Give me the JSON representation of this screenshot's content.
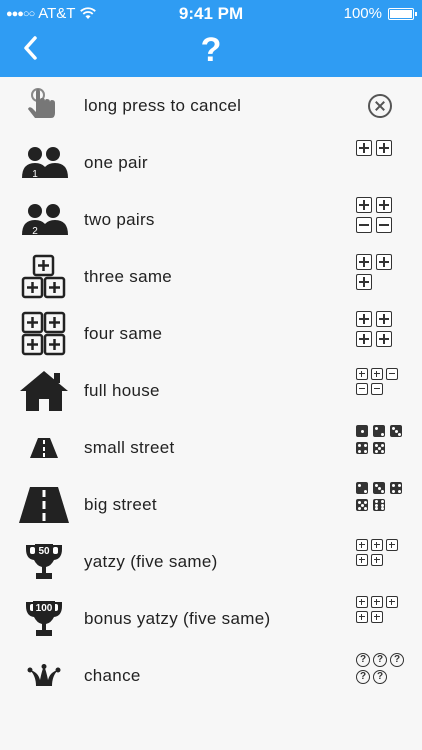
{
  "statusbar": {
    "carrier": "AT&T",
    "time": "9:41 PM",
    "battery": "100%"
  },
  "navbar": {
    "title": "?"
  },
  "rows": [
    {
      "label": "long press to cancel",
      "icon": "hand-press-icon"
    },
    {
      "label": "one pair",
      "icon": "pair-icon"
    },
    {
      "label": "two pairs",
      "icon": "two-pairs-icon"
    },
    {
      "label": "three same",
      "icon": "three-same-icon"
    },
    {
      "label": "four same",
      "icon": "four-same-icon"
    },
    {
      "label": "full house",
      "icon": "house-icon"
    },
    {
      "label": "small street",
      "icon": "small-road-icon"
    },
    {
      "label": "big street",
      "icon": "big-road-icon"
    },
    {
      "label": "yatzy (five same)",
      "icon": "trophy-50-icon"
    },
    {
      "label": "bonus yatzy (five same)",
      "icon": "trophy-100-icon"
    },
    {
      "label": "chance",
      "icon": "jester-hat-icon"
    }
  ],
  "badges": {
    "one_pair": "1",
    "two_pairs": "2",
    "yatzy": "50",
    "bonus": "100"
  },
  "colors": {
    "accent": "#2f9cf3",
    "icon": "#222222",
    "background": "#f7f7f7"
  }
}
